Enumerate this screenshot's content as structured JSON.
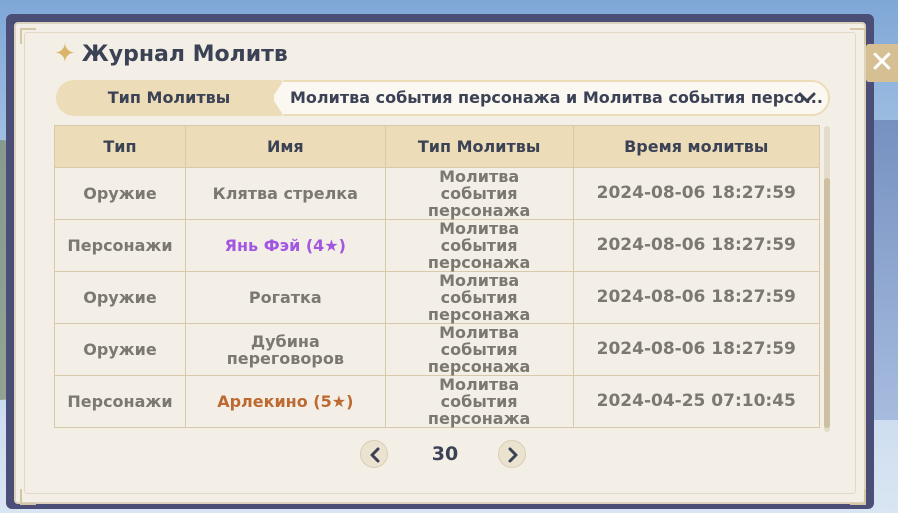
{
  "title": "Журнал Молитв",
  "close_label": "✕",
  "wish_type_label": "Тип Молитвы",
  "wish_type_selected": "Молитва события персонажа и Молитва события персо...",
  "table": {
    "headers": [
      "Тип",
      "Имя",
      "Тип Молитвы",
      "Время молитвы"
    ],
    "rows": [
      {
        "type": "Оружие",
        "name": "Клятва стрелка",
        "wish": "Молитва события персонажа",
        "time": "2024-08-06 18:27:59",
        "rarity": 3
      },
      {
        "type": "Персонажи",
        "name": "Янь Фэй (4★)",
        "wish": "Молитва события персонажа",
        "time": "2024-08-06 18:27:59",
        "rarity": 4
      },
      {
        "type": "Оружие",
        "name": "Рогатка",
        "wish": "Молитва события персонажа",
        "time": "2024-08-06 18:27:59",
        "rarity": 3
      },
      {
        "type": "Оружие",
        "name": "Дубина переговоров",
        "wish": "Молитва события персонажа",
        "time": "2024-08-06 18:27:59",
        "rarity": 3
      },
      {
        "type": "Персонажи",
        "name": "Арлекино (5★)",
        "wish": "Молитва события персонажа",
        "time": "2024-04-25 07:10:45",
        "rarity": 5
      }
    ]
  },
  "pagination": {
    "page": "30"
  },
  "colors": {
    "rarity4": "#a256e1",
    "rarity5": "#bd6932",
    "rarity3": "#7a7870"
  }
}
